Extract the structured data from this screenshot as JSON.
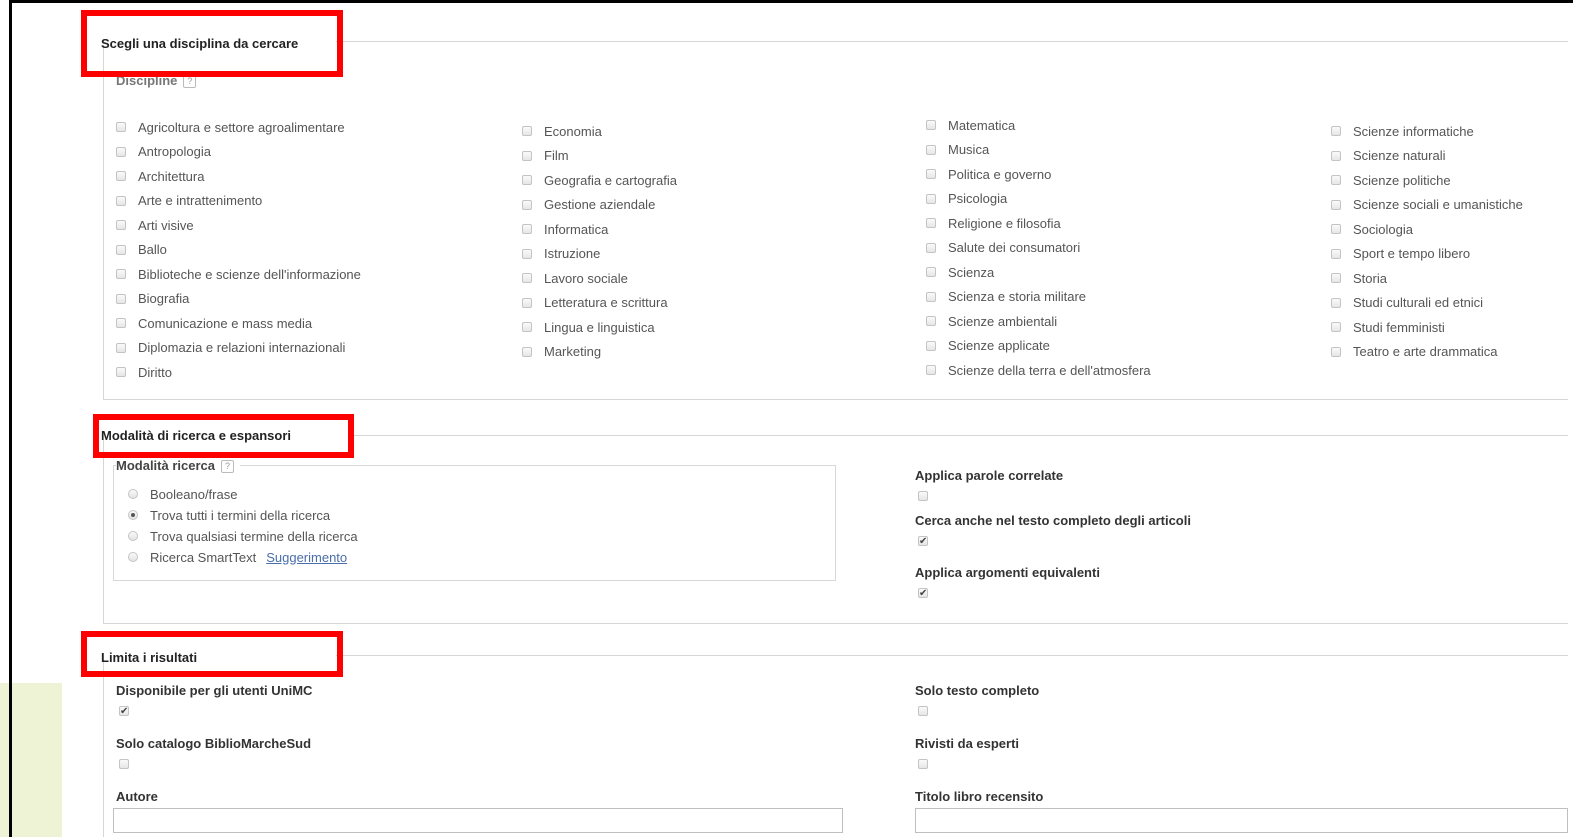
{
  "sections": {
    "discipline": {
      "title": "Scegli una disciplina da cercare",
      "group_label": "Discipline",
      "help": "?",
      "columns": [
        [
          "Agricoltura e settore agroalimentare",
          "Antropologia",
          "Architettura",
          "Arte e intrattenimento",
          "Arti visive",
          "Ballo",
          "Biblioteche e scienze dell'informazione",
          "Biografia",
          "Comunicazione e mass media",
          "Diplomazia e relazioni internazionali",
          "Diritto"
        ],
        [
          "Economia",
          "Film",
          "Geografia e cartografia",
          "Gestione aziendale",
          "Informatica",
          "Istruzione",
          "Lavoro sociale",
          "Letteratura e scrittura",
          "Lingua e linguistica",
          "Marketing"
        ],
        [
          "Matematica",
          "Musica",
          "Politica e governo",
          "Psicologia",
          "Religione e filosofia",
          "Salute dei consumatori",
          "Scienza",
          "Scienza e storia militare",
          "Scienze ambientali",
          "Scienze applicate",
          "Scienze della terra e dell'atmosfera"
        ],
        [
          "Scienze informatiche",
          "Scienze naturali",
          "Scienze politiche",
          "Scienze sociali e umanistiche",
          "Sociologia",
          "Sport e tempo libero",
          "Storia",
          "Studi culturali ed etnici",
          "Studi femministi",
          "Teatro e arte drammatica"
        ]
      ]
    },
    "modes": {
      "title": "Modalità di ricerca e espansori",
      "group_label": "Modalità ricerca",
      "help": "?",
      "options": [
        {
          "label": "Booleano/frase",
          "selected": false
        },
        {
          "label": "Trova tutti i termini della ricerca",
          "selected": true
        },
        {
          "label": "Trova qualsiasi termine della ricerca",
          "selected": false
        },
        {
          "label": "Ricerca SmartText",
          "selected": false
        }
      ],
      "suggestion_link": "Suggerimento",
      "expanders": [
        {
          "label": "Applica parole correlate",
          "checked": false
        },
        {
          "label": "Cerca anche nel testo completo degli articoli",
          "checked": true
        },
        {
          "label": "Applica argomenti equivalenti",
          "checked": true
        }
      ]
    },
    "limits": {
      "title": "Limita i risultati",
      "left": [
        {
          "label": "Disponibile per gli utenti UniMC",
          "checked": true
        },
        {
          "label": "Solo catalogo BiblioMarcheSud",
          "checked": false
        }
      ],
      "right": [
        {
          "label": "Solo testo completo",
          "checked": false
        },
        {
          "label": "Rivisti da esperti",
          "checked": false
        }
      ],
      "author_label": "Autore",
      "author_value": "",
      "book_title_label": "Titolo libro recensito",
      "book_title_value": ""
    }
  },
  "colors": {
    "highlight": "#ff0000",
    "accent": "#eef3d6",
    "link": "#4a6ea9"
  }
}
